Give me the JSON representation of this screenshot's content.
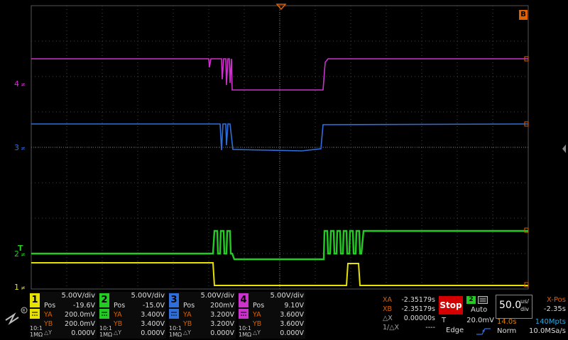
{
  "channels": [
    {
      "num": "1",
      "color": "#e8e000",
      "scale": "5.00V/div",
      "pos_label": "Pos",
      "pos": "-19.6V",
      "ya_label": "YA",
      "ya": "200.0mV",
      "yb_label": "YB",
      "yb": "200.0mV",
      "dy_label": "△Y",
      "dy": "0.000V",
      "imp1": "10:1",
      "imp2": "1MΩ"
    },
    {
      "num": "2",
      "color": "#22cc22",
      "scale": "5.00V/div",
      "pos_label": "Pos",
      "pos": "-15.0V",
      "ya_label": "YA",
      "ya": "3.400V",
      "yb_label": "YB",
      "yb": "3.400V",
      "dy_label": "△Y",
      "dy": "0.000V",
      "imp1": "10:1",
      "imp2": "1MΩ"
    },
    {
      "num": "3",
      "color": "#2f6fdc",
      "scale": "5.00V/div",
      "pos_label": "Pos",
      "pos": "200mV",
      "ya_label": "YA",
      "ya": "3.200V",
      "yb_label": "YB",
      "yb": "3.200V",
      "dy_label": "△Y",
      "dy": "0.000V",
      "imp1": "10:1",
      "imp2": "1MΩ"
    },
    {
      "num": "4",
      "color": "#cc33cc",
      "scale": "5.00V/div",
      "pos_label": "Pos",
      "pos": "9.10V",
      "ya_label": "YA",
      "ya": "3.600V",
      "yb_label": "YB",
      "yb": "3.600V",
      "dy_label": "△Y",
      "dy": "0.000V",
      "imp1": "10:1",
      "imp2": "1MΩ"
    }
  ],
  "markers": {
    "ch1": "1",
    "ch2": "2",
    "ch3": "3",
    "ch4": "4",
    "trigger": "T",
    "b_badge": "B"
  },
  "cursor": {
    "xa_label": "XA",
    "xa": "-2.35179s",
    "xb_label": "XB",
    "xb": "-2.35179s",
    "dx_label": "△X",
    "dx": "0.00000s",
    "inv_label": "1/△X",
    "inv": "----"
  },
  "run": {
    "stop_label": "Stop"
  },
  "trigger": {
    "source": "2",
    "mode": "Auto",
    "level_label": "T",
    "level": "20.0mV",
    "type": "Edge"
  },
  "timebase": {
    "value": "50.0",
    "unit_top": "us/",
    "unit_bot": "div",
    "xpos_label": "X-Pos",
    "xpos": "-2.35s",
    "time": "14.0s",
    "mpts": "140Mpts",
    "acq_mode": "Norm",
    "rate": "10.0MSa/s"
  },
  "logo_text": "ZLG",
  "colors": {
    "ch1": "#e8e000",
    "ch2": "#22cc22",
    "ch3": "#2f6fdc",
    "ch4": "#cc33cc",
    "orange": "#e06000",
    "grid": "#555555"
  }
}
